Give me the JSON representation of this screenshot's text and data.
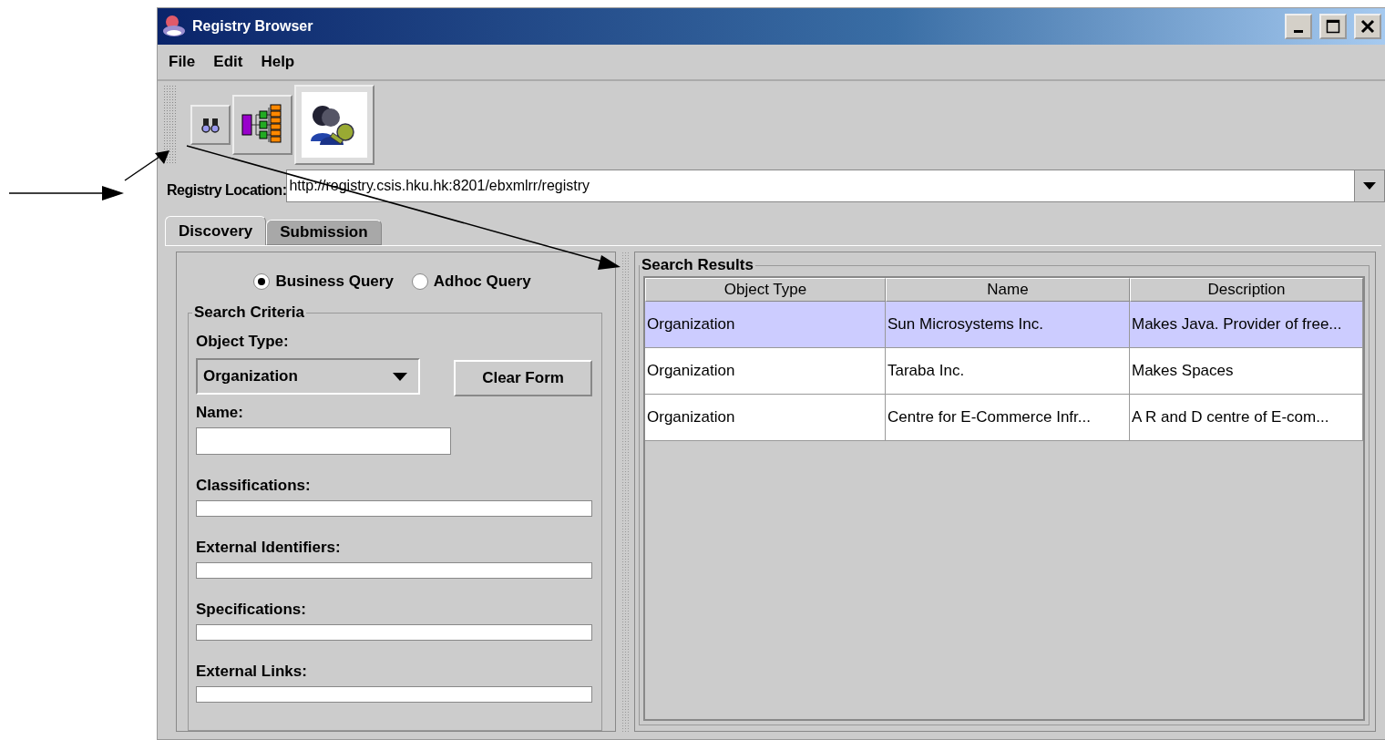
{
  "window": {
    "title": "Registry Browser"
  },
  "menu": [
    "File",
    "Edit",
    "Help"
  ],
  "toolbar": [
    {
      "kind": "search",
      "selected": false
    },
    {
      "kind": "tree",
      "selected": false
    },
    {
      "kind": "users",
      "selected": true
    }
  ],
  "registry_location": {
    "label": "Registry Location:",
    "value": "http://registry.csis.hku.hk:8201/ebxmlrr/registry"
  },
  "tabs": [
    {
      "label": "Discovery",
      "selected": true
    },
    {
      "label": "Submission",
      "selected": false
    }
  ],
  "query_types": [
    {
      "label": "Business Query",
      "selected": true
    },
    {
      "label": "Adhoc Query",
      "selected": false
    }
  ],
  "search_criteria": {
    "title": "Search Criteria",
    "object_type_label": "Object Type:",
    "object_type": "Organization",
    "clear_button": "Clear Form",
    "name_label": "Name:",
    "lists": [
      "Classifications:",
      "External Identifiers:",
      "Specifications:",
      "External Links:"
    ]
  },
  "search_results": {
    "title": "Search Results",
    "columns": [
      "Object Type",
      "Name",
      "Description"
    ],
    "rows": [
      {
        "cells": [
          "Organization",
          "Sun Microsystems Inc.",
          "Makes Java. Provider of free..."
        ],
        "selected": true
      },
      {
        "cells": [
          "Organization",
          "Taraba Inc.",
          "Makes Spaces"
        ],
        "selected": false
      },
      {
        "cells": [
          "Organization",
          "Centre for E-Commerce Infr...",
          "A R and D centre of E-com..."
        ],
        "selected": false
      }
    ]
  }
}
